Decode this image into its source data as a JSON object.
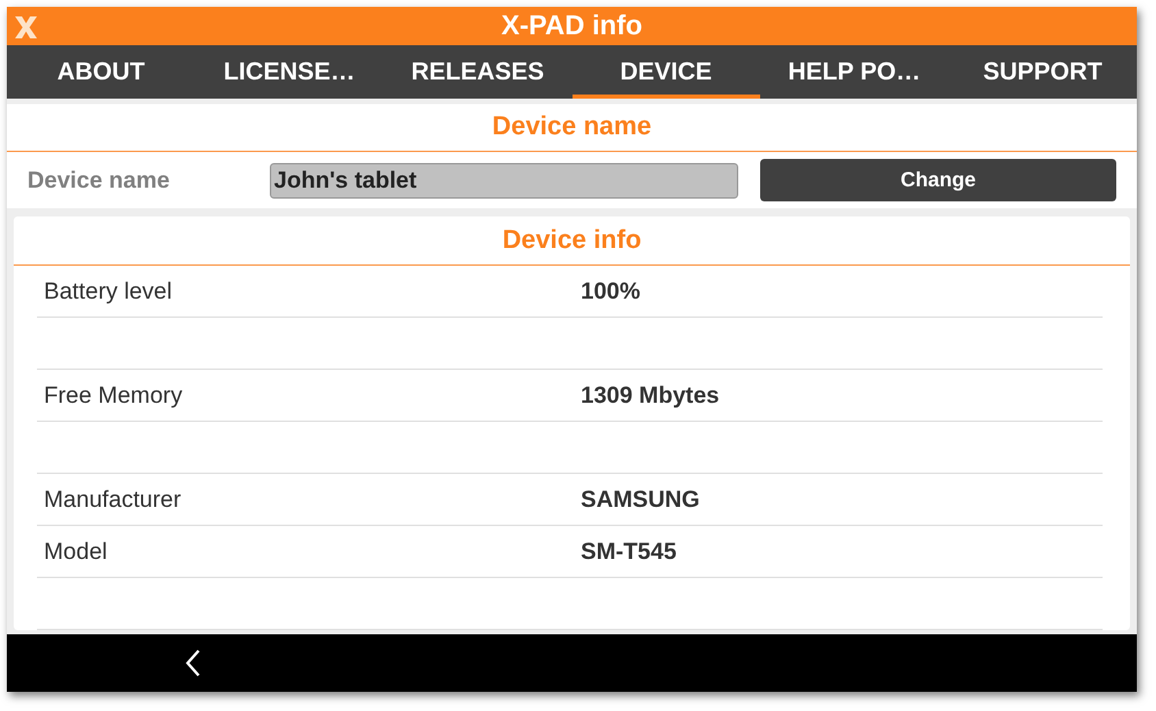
{
  "window": {
    "title": "X-PAD info"
  },
  "tabs": [
    {
      "label": "ABOUT",
      "selected": false
    },
    {
      "label": "LICENSE…",
      "selected": false
    },
    {
      "label": "RELEASES",
      "selected": false
    },
    {
      "label": "DEVICE",
      "selected": true
    },
    {
      "label": "HELP PO…",
      "selected": false
    },
    {
      "label": "SUPPORT",
      "selected": false
    }
  ],
  "device_name": {
    "heading": "Device name",
    "label": "Device name",
    "value": "John's tablet",
    "button": "Change"
  },
  "device_info": {
    "heading": "Device info",
    "rows": [
      {
        "kind": "item",
        "label": "Battery level",
        "value": "100%"
      },
      {
        "kind": "spacer"
      },
      {
        "kind": "item",
        "label": "Free Memory",
        "value": "1309 Mbytes"
      },
      {
        "kind": "spacer"
      },
      {
        "kind": "item",
        "label": "Manufacturer",
        "value": "SAMSUNG"
      },
      {
        "kind": "item",
        "label": "Model",
        "value": "SM-T545"
      }
    ]
  }
}
